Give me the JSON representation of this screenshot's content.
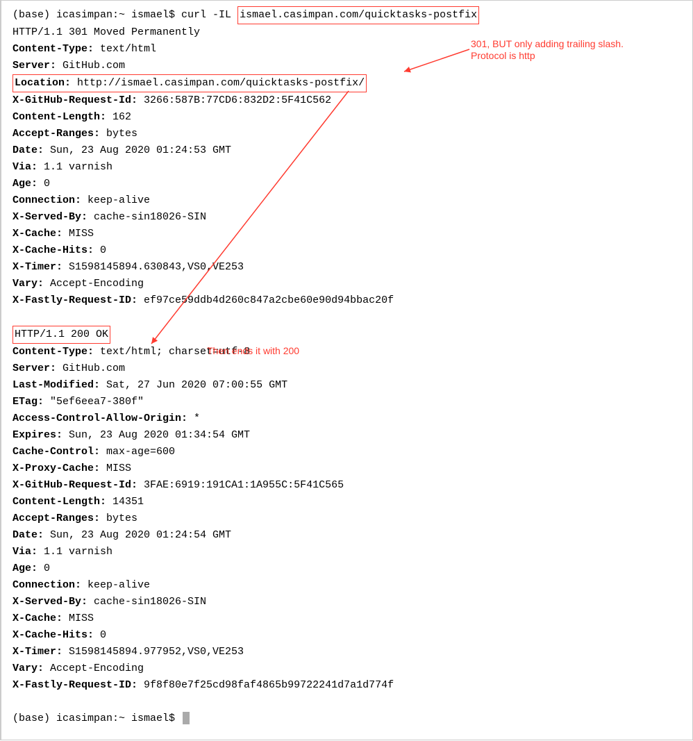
{
  "prompt1_prefix": "(base) icasimpan:~ ismael$ curl -IL ",
  "prompt1_url": "ismael.casimpan.com/quicktasks-postfix",
  "r1_status": "HTTP/1.1 301 Moved Permanently",
  "r1_h": [
    {
      "k": "Content-Type:",
      "v": " text/html"
    },
    {
      "k": "Server:",
      "v": " GitHub.com"
    }
  ],
  "r1_loc_k": "Location:",
  "r1_loc_v": " http://ismael.casimpan.com/quicktasks-postfix/",
  "r1_t": [
    {
      "k": "X-GitHub-Request-Id:",
      "v": " 3266:587B:77CD6:832D2:5F41C562"
    },
    {
      "k": "Content-Length:",
      "v": " 162"
    },
    {
      "k": "Accept-Ranges:",
      "v": " bytes"
    },
    {
      "k": "Date:",
      "v": " Sun, 23 Aug 2020 01:24:53 GMT"
    },
    {
      "k": "Via:",
      "v": " 1.1 varnish"
    },
    {
      "k": "Age:",
      "v": " 0"
    },
    {
      "k": "Connection:",
      "v": " keep-alive"
    },
    {
      "k": "X-Served-By:",
      "v": " cache-sin18026-SIN"
    },
    {
      "k": "X-Cache:",
      "v": " MISS"
    },
    {
      "k": "X-Cache-Hits:",
      "v": " 0"
    },
    {
      "k": "X-Timer:",
      "v": " S1598145894.630843,VS0,VE253"
    },
    {
      "k": "Vary:",
      "v": " Accept-Encoding"
    },
    {
      "k": "X-Fastly-Request-ID:",
      "v": " ef97ce59ddb4d260c847a2cbe60e90d94bbac20f"
    }
  ],
  "r2_status": "HTTP/1.1 200 OK",
  "r2_h": [
    {
      "k": "Content-Type:",
      "v": " text/html; charset=utf-8"
    },
    {
      "k": "Server:",
      "v": " GitHub.com"
    },
    {
      "k": "Last-Modified:",
      "v": " Sat, 27 Jun 2020 07:00:55 GMT"
    },
    {
      "k": "ETag:",
      "v": " \"5ef6eea7-380f\""
    },
    {
      "k": "Access-Control-Allow-Origin:",
      "v": " *"
    },
    {
      "k": "Expires:",
      "v": " Sun, 23 Aug 2020 01:34:54 GMT"
    },
    {
      "k": "Cache-Control:",
      "v": " max-age=600"
    },
    {
      "k": "X-Proxy-Cache:",
      "v": " MISS"
    },
    {
      "k": "X-GitHub-Request-Id:",
      "v": " 3FAE:6919:191CA1:1A955C:5F41C565"
    },
    {
      "k": "Content-Length:",
      "v": " 14351"
    },
    {
      "k": "Accept-Ranges:",
      "v": " bytes"
    },
    {
      "k": "Date:",
      "v": " Sun, 23 Aug 2020 01:24:54 GMT"
    },
    {
      "k": "Via:",
      "v": " 1.1 varnish"
    },
    {
      "k": "Age:",
      "v": " 0"
    },
    {
      "k": "Connection:",
      "v": " keep-alive"
    },
    {
      "k": "X-Served-By:",
      "v": " cache-sin18026-SIN"
    },
    {
      "k": "X-Cache:",
      "v": " MISS"
    },
    {
      "k": "X-Cache-Hits:",
      "v": " 0"
    },
    {
      "k": "X-Timer:",
      "v": " S1598145894.977952,VS0,VE253"
    },
    {
      "k": "Vary:",
      "v": " Accept-Encoding"
    },
    {
      "k": "X-Fastly-Request-ID:",
      "v": " 9f8f80e7f25cd98faf4865b99722241d7a1d774f"
    }
  ],
  "prompt2": "(base) icasimpan:~ ismael$ ",
  "annot1a": "301, BUT only adding trailing slash.",
  "annot1b": "Protocol is http",
  "annot2": "Then ends it with 200"
}
